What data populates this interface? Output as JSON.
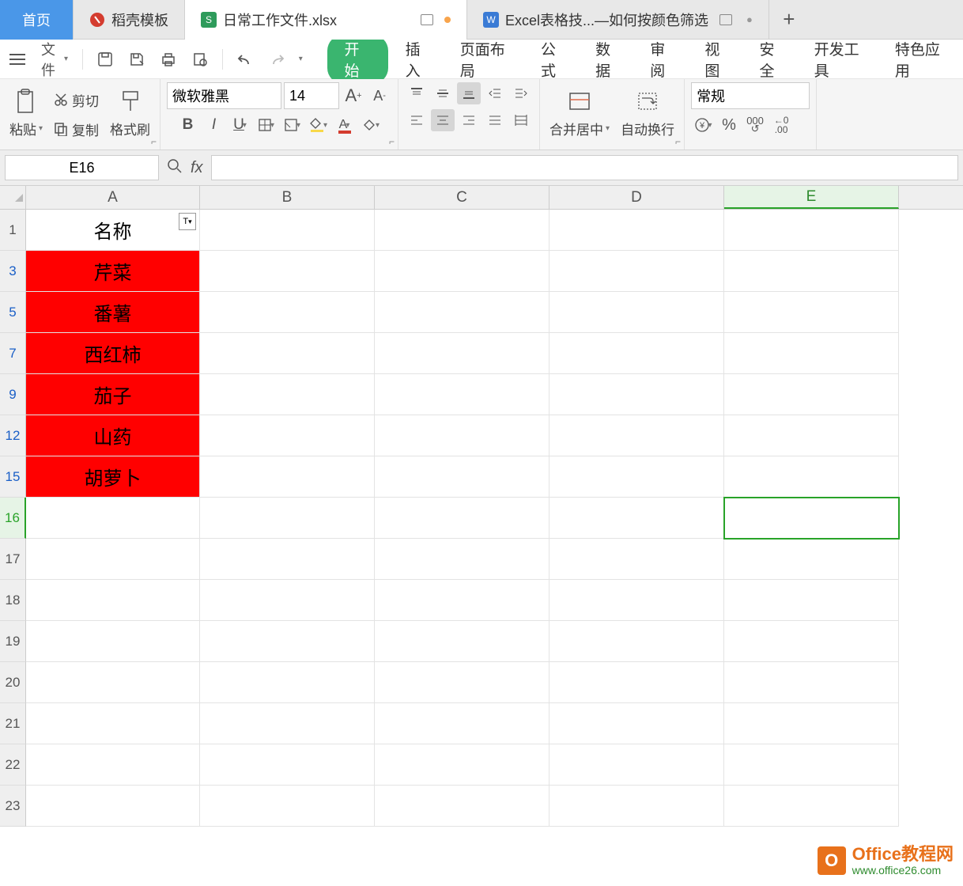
{
  "tabs": {
    "home": "首页",
    "template": "稻壳模板",
    "file1": "日常工作文件.xlsx",
    "file2": "Excel表格技...—如何按颜色筛选"
  },
  "menu": {
    "file": "文件",
    "start": "开始",
    "insert": "插入",
    "pagelayout": "页面布局",
    "formula": "公式",
    "data": "数据",
    "review": "审阅",
    "view": "视图",
    "security": "安全",
    "devtools": "开发工具",
    "special": "特色应用"
  },
  "ribbon": {
    "paste": "粘贴",
    "cut": "剪切",
    "copy": "复制",
    "format_painter": "格式刷",
    "font_name": "微软雅黑",
    "font_size": "14",
    "merge_center": "合并居中",
    "wrap_text": "自动换行",
    "number_format": "常规"
  },
  "namebox_value": "E16",
  "columns": [
    "A",
    "B",
    "C",
    "D",
    "E"
  ],
  "rows": [
    {
      "num": "1",
      "val": "名称",
      "red": false,
      "filterbtn": true
    },
    {
      "num": "3",
      "val": "芹菜",
      "red": true,
      "filt": true
    },
    {
      "num": "5",
      "val": "番薯",
      "red": true,
      "filt": true
    },
    {
      "num": "7",
      "val": "西红柿",
      "red": true,
      "filt": true
    },
    {
      "num": "9",
      "val": "茄子",
      "red": true,
      "filt": true
    },
    {
      "num": "12",
      "val": "山药",
      "red": true,
      "filt": true
    },
    {
      "num": "15",
      "val": "胡萝卜",
      "red": true,
      "filt": true
    },
    {
      "num": "16",
      "val": "",
      "red": false,
      "selrow": true
    },
    {
      "num": "17",
      "val": "",
      "red": false
    },
    {
      "num": "18",
      "val": "",
      "red": false
    },
    {
      "num": "19",
      "val": "",
      "red": false
    },
    {
      "num": "20",
      "val": "",
      "red": false
    },
    {
      "num": "21",
      "val": "",
      "red": false
    },
    {
      "num": "22",
      "val": "",
      "red": false
    },
    {
      "num": "23",
      "val": "",
      "red": false
    }
  ],
  "watermark": {
    "line1": "Office教程网",
    "line2": "www.office26.com"
  }
}
